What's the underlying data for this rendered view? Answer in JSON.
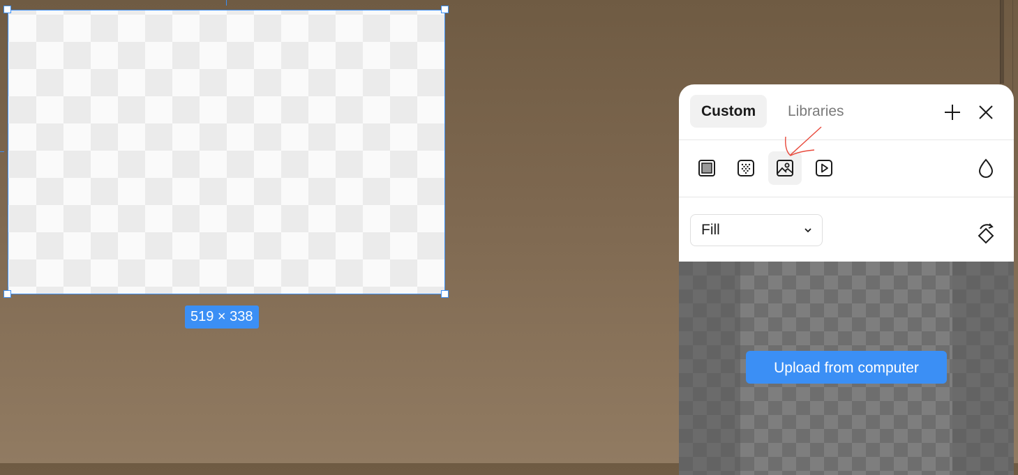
{
  "canvas": {
    "dimension_badge": "519 × 338"
  },
  "fill_panel": {
    "tabs": [
      {
        "label": "Custom",
        "active": true
      },
      {
        "label": "Libraries",
        "active": false
      }
    ],
    "add_icon": "plus-icon",
    "close_icon": "close-icon",
    "fill_types": [
      {
        "icon": "solid-fill-icon"
      },
      {
        "icon": "noise-fill-icon"
      },
      {
        "icon": "image-fill-icon",
        "active": true
      },
      {
        "icon": "video-fill-icon"
      }
    ],
    "opacity_icon": "drop-icon",
    "fill_mode": {
      "value": "Fill"
    },
    "rotate_icon": "rotate-icon",
    "upload_label": "Upload from computer"
  },
  "colors": {
    "accent": "#3b8ff5",
    "annotation": "#e8483a"
  }
}
